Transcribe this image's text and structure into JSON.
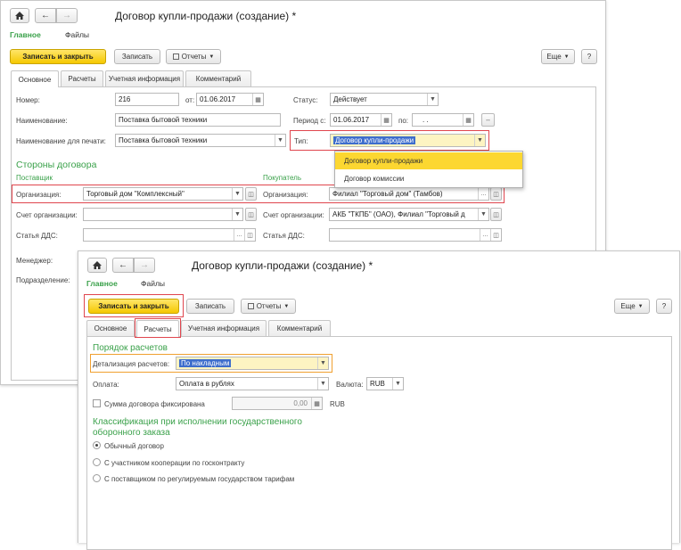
{
  "back": {
    "toolbar": {
      "home_icon": "home-icon",
      "back_icon": "arrow-left-icon",
      "forward_icon": "arrow-right-icon"
    },
    "title": "Договор купли-продажи (создание) *",
    "sections": [
      "Главное",
      "Файлы"
    ],
    "buttons": {
      "save_close": "Записать и закрыть",
      "save": "Записать",
      "reports": "Отчеты",
      "more": "Еще",
      "help": "?"
    },
    "tabs": [
      "Основное",
      "Расчеты",
      "Учетная информация",
      "Комментарий"
    ],
    "fields": {
      "number_label": "Номер:",
      "number_value": "216",
      "from_label": "от:",
      "date_value": "01.06.2017",
      "status_label": "Статус:",
      "status_value": "Действует",
      "name_label": "Наименование:",
      "name_value": "Поставка бытовой техники",
      "period_label": "Период с:",
      "period_from": "01.06.2017",
      "period_to_label": "по:",
      "period_to": ". .",
      "print_name_label": "Наименование для печати:",
      "print_name_value": "Поставка бытовой техники",
      "type_label": "Тип:",
      "type_value": "Договор купли-продажи"
    },
    "parties": {
      "header": "Стороны договора",
      "supplier": "Поставщик",
      "buyer": "Покупатель",
      "org_label": "Организация:",
      "org_value": "Торговый дом \"Комплексный\"",
      "buyer_org_label": "Организация:",
      "buyer_org_value": "Филиал \"Торговый дом\" (Тамбов)",
      "account_label": "Счет организации:",
      "account_value": "",
      "buyer_account_label": "Счет организации:",
      "buyer_account_value": "АКБ \"ТКПБ\" (ОАО), Филиал \"Торговый д",
      "dds_label": "Статья ДДС:",
      "buyer_dds_label": "Статья ДДС:",
      "manager_label": "Менеджер:",
      "division_label": "Подразделение:"
    },
    "type_dropdown": [
      "Договор купли-продажи",
      "Договор комиссии"
    ]
  },
  "front": {
    "title": "Договор купли-продажи (создание) *",
    "sections": [
      "Главное",
      "Файлы"
    ],
    "buttons": {
      "save_close": "Записать и закрыть",
      "save": "Записать",
      "reports": "Отчеты",
      "more": "Еще",
      "help": "?"
    },
    "tabs": [
      "Основное",
      "Расчеты",
      "Учетная информация",
      "Комментарий"
    ],
    "payment": {
      "header": "Порядок расчетов",
      "detail_label": "Детализация расчетов:",
      "detail_value": "По накладным",
      "pay_label": "Оплата:",
      "pay_value": "Оплата в рублях",
      "currency_label": "Валюта:",
      "currency_value": "RUB",
      "fixed_sum_label": "Сумма договора фиксирована",
      "fixed_sum_value": "0,00",
      "fixed_sum_currency": "RUB"
    },
    "classification": {
      "header_line1": "Классификация при исполнении государственного",
      "header_line2": "оборонного заказа",
      "options": [
        "Обычный договор",
        "С участником кооперации по госконтракту",
        "С поставщиком по регулируемым государством тарифам"
      ],
      "selected": 0
    }
  }
}
